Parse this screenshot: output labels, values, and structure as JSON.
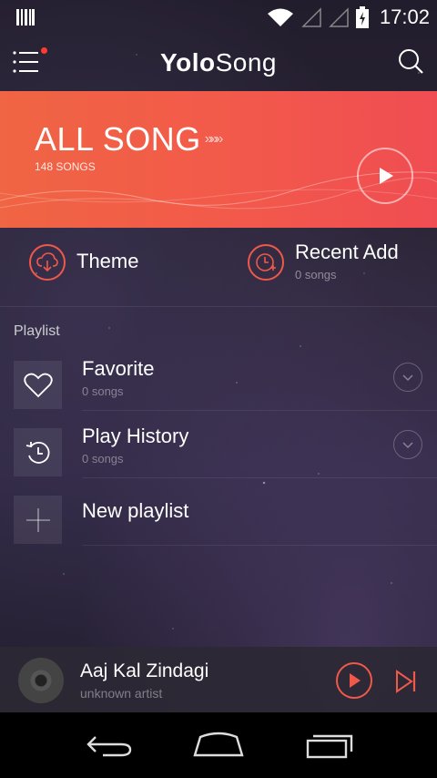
{
  "status_bar": {
    "time": "17:02"
  },
  "app": {
    "title_bold": "Yolo",
    "title_light": "Song"
  },
  "banner": {
    "title": "ALL SONG",
    "arrows": "»»»",
    "subtitle": "148 SONGS"
  },
  "quick": {
    "theme_label": "Theme",
    "recent_label": "Recent Add",
    "recent_count": "0 songs"
  },
  "section": {
    "playlist_label": "Playlist"
  },
  "playlists": [
    {
      "name": "Favorite",
      "count": "0 songs",
      "icon": "heart-icon"
    },
    {
      "name": "Play History",
      "count": "0 songs",
      "icon": "history-icon"
    },
    {
      "name": "New playlist",
      "icon": "plus-icon"
    }
  ],
  "now_playing": {
    "title": "Aaj Kal Zindagi",
    "artist": "unknown artist"
  },
  "colors": {
    "accent": "#f0584a",
    "banner_start": "#f06543",
    "banner_end": "#f04d52"
  }
}
